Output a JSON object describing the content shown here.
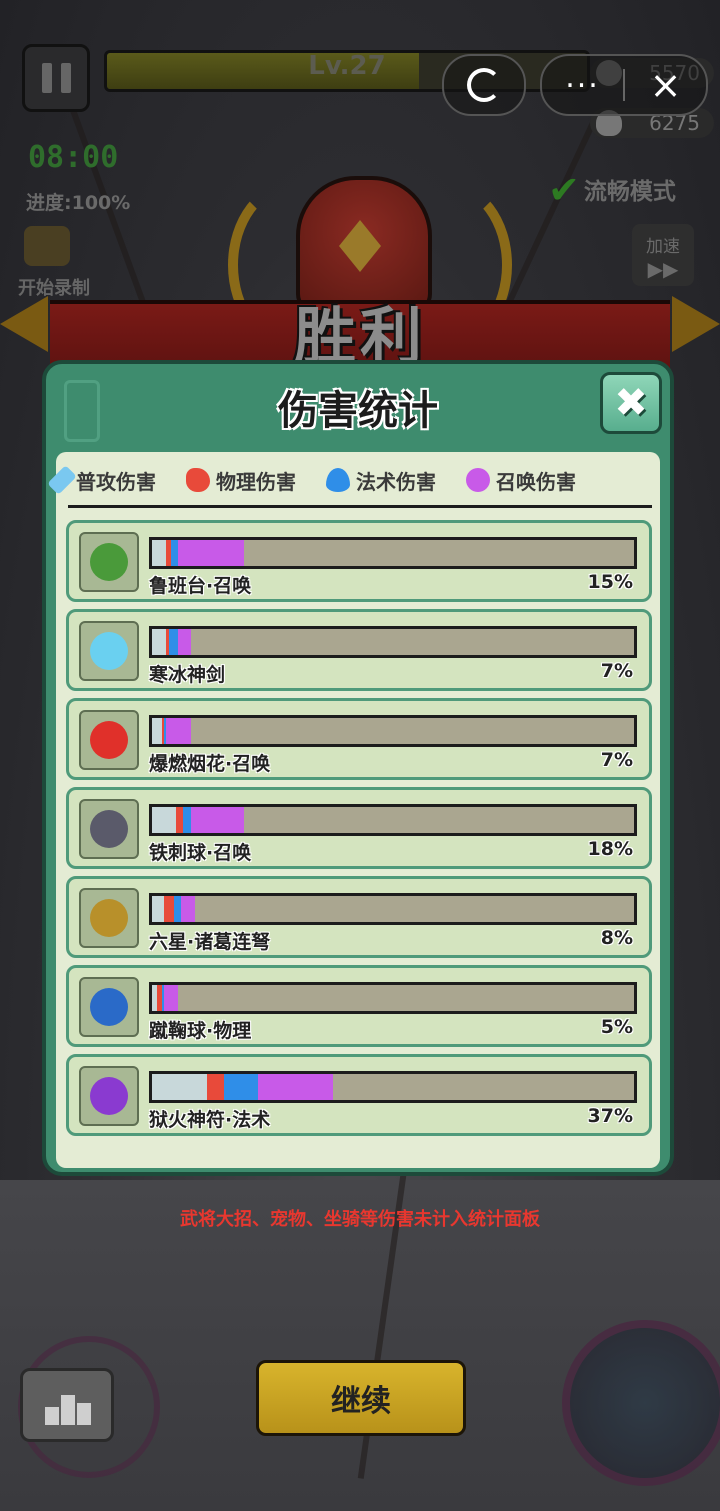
{
  "hud": {
    "level": "Lv.27",
    "level_progress": 0.65,
    "coins": "5570",
    "kills": "6275",
    "timer": "08:00",
    "progress": "进度:100%",
    "record": "开始录制",
    "smooth_mode": "流畅模式",
    "speed": "加速"
  },
  "banner": {
    "title": "胜利"
  },
  "panel": {
    "title": "伤害统计",
    "tabs": [
      {
        "label": "普攻伤害",
        "color": "#7ac8f0"
      },
      {
        "label": "物理伤害",
        "color": "#e84a3a"
      },
      {
        "label": "法术伤害",
        "color": "#2f8ee8"
      },
      {
        "label": "召唤伤害",
        "color": "#c85ae8"
      }
    ],
    "items": [
      {
        "name": "鲁班台·召唤",
        "percent": "15%",
        "icon_color": "#4a9a3a",
        "segments": [
          0.03,
          0.01,
          0.015,
          0.135
        ]
      },
      {
        "name": "寒冰神剑",
        "percent": "7%",
        "icon_color": "#6ad0f0",
        "segments": [
          0.03,
          0.005,
          0.02,
          0.025
        ]
      },
      {
        "name": "爆燃烟花·召唤",
        "percent": "7%",
        "icon_color": "#e0302a",
        "segments": [
          0.02,
          0.005,
          0.005,
          0.05
        ]
      },
      {
        "name": "铁刺球·召唤",
        "percent": "18%",
        "icon_color": "#5a5a6a",
        "segments": [
          0.05,
          0.015,
          0.015,
          0.11
        ]
      },
      {
        "name": "六星·诸葛连弩",
        "percent": "8%",
        "icon_color": "#b8902a",
        "segments": [
          0.025,
          0.02,
          0.015,
          0.03
        ]
      },
      {
        "name": "蹴鞠球·物理",
        "percent": "5%",
        "icon_color": "#2a6ac8",
        "segments": [
          0.01,
          0.01,
          0.005,
          0.03
        ]
      },
      {
        "name": "狱火神符·法术",
        "percent": "37%",
        "icon_color": "#8a3ad0",
        "segments": [
          0.115,
          0.035,
          0.07,
          0.155
        ]
      }
    ]
  },
  "note": "武将大招、宠物、坐骑等伤害未计入统计面板",
  "continue_label": "继续"
}
